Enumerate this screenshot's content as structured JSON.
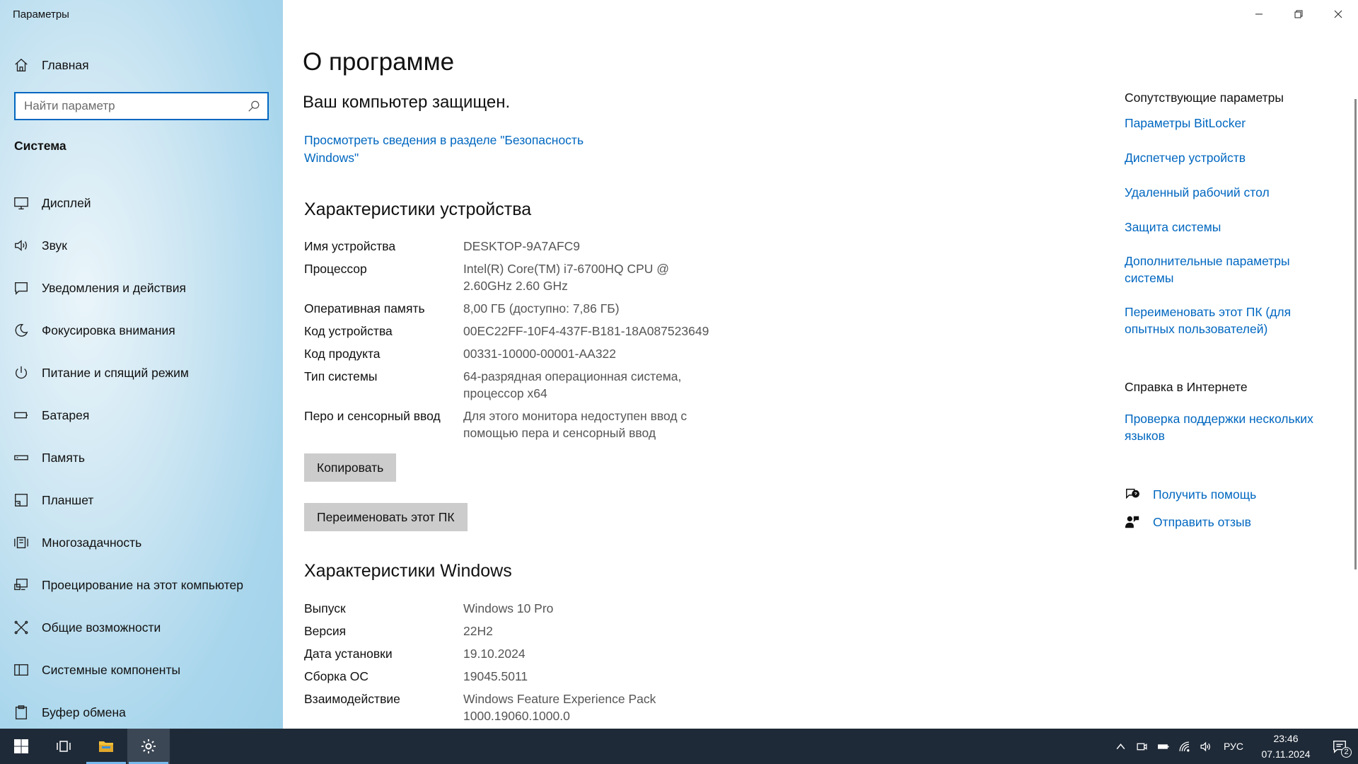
{
  "window": {
    "title": "Параметры"
  },
  "sidebar": {
    "home_label": "Главная",
    "search_placeholder": "Найти параметр",
    "section_title": "Система",
    "items": [
      {
        "label": "Дисплей",
        "icon": "display-icon"
      },
      {
        "label": "Звук",
        "icon": "speaker-icon"
      },
      {
        "label": "Уведомления и действия",
        "icon": "notification-icon"
      },
      {
        "label": "Фокусировка внимания",
        "icon": "moon-icon"
      },
      {
        "label": "Питание и спящий режим",
        "icon": "power-icon"
      },
      {
        "label": "Батарея",
        "icon": "battery-icon"
      },
      {
        "label": "Память",
        "icon": "storage-icon"
      },
      {
        "label": "Планшет",
        "icon": "tablet-icon"
      },
      {
        "label": "Многозадачность",
        "icon": "multitasking-icon"
      },
      {
        "label": "Проецирование на этот компьютер",
        "icon": "projecting-icon"
      },
      {
        "label": "Общие возможности",
        "icon": "shared-experiences-icon"
      },
      {
        "label": "Системные компоненты",
        "icon": "components-icon"
      },
      {
        "label": "Буфер обмена",
        "icon": "clipboard-icon"
      }
    ]
  },
  "main": {
    "title": "О программе",
    "protection_status": "Ваш компьютер защищен.",
    "security_link": "Просмотреть сведения в разделе \"Безопасность Windows\"",
    "device_specs": {
      "heading": "Характеристики устройства",
      "rows": [
        {
          "label": "Имя устройства",
          "value": "DESKTOP-9A7AFC9"
        },
        {
          "label": "Процессор",
          "value": "Intel(R) Core(TM) i7-6700HQ CPU @ 2.60GHz   2.60 GHz"
        },
        {
          "label": "Оперативная память",
          "value": "8,00 ГБ (доступно: 7,86 ГБ)"
        },
        {
          "label": "Код устройства",
          "value": "00EC22FF-10F4-437F-B181-18A087523649"
        },
        {
          "label": "Код продукта",
          "value": "00331-10000-00001-AA322"
        },
        {
          "label": "Тип системы",
          "value": "64-разрядная операционная система, процессор x64"
        },
        {
          "label": "Перо и сенсорный ввод",
          "value": "Для этого монитора недоступен ввод с помощью пера и сенсорный ввод"
        }
      ]
    },
    "copy_button": "Копировать",
    "rename_button": "Переименовать этот ПК",
    "windows_specs": {
      "heading": "Характеристики Windows",
      "rows": [
        {
          "label": "Выпуск",
          "value": "Windows 10 Pro"
        },
        {
          "label": "Версия",
          "value": "22H2"
        },
        {
          "label": "Дата установки",
          "value": "19.10.2024"
        },
        {
          "label": "Сборка ОС",
          "value": "19045.5011"
        },
        {
          "label": "Взаимодействие",
          "value": "Windows Feature Experience Pack 1000.19060.1000.0"
        }
      ]
    }
  },
  "related": {
    "heading": "Сопутствующие параметры",
    "links": [
      "Параметры BitLocker",
      "Диспетчер устройств",
      "Удаленный рабочий стол",
      "Защита системы",
      "Дополнительные параметры системы",
      "Переименовать этот ПК (для опытных пользователей)"
    ],
    "web_help_heading": "Справка в Интернете",
    "web_help_link": "Проверка поддержки нескольких языков",
    "get_help": "Получить помощь",
    "feedback": "Отправить отзыв"
  },
  "taskbar": {
    "language": "РУС",
    "time": "23:46",
    "date": "07.11.2024",
    "notification_count": "2"
  },
  "colors": {
    "accent": "#0067c0",
    "taskbar": "#1f2a38",
    "button": "#cccccc"
  }
}
